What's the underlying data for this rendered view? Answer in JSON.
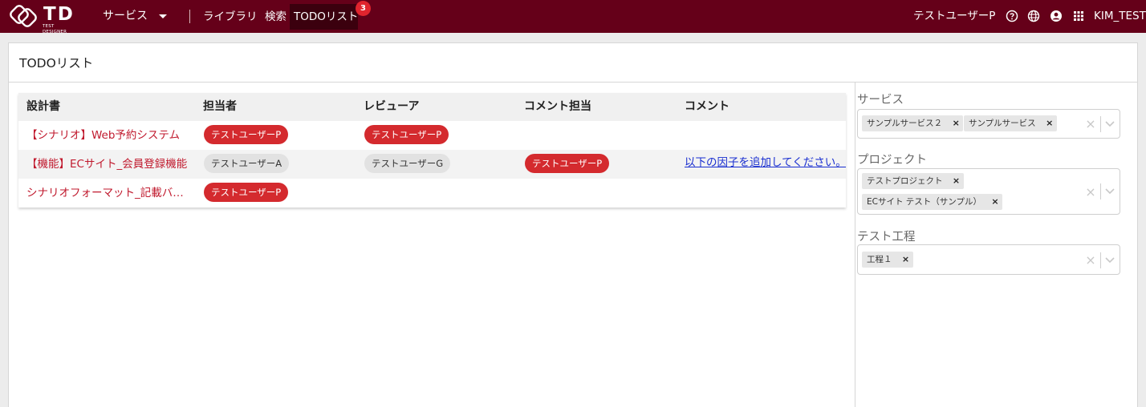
{
  "header": {
    "logo_text": "TD",
    "logo_sub": "TEST DESIGNER",
    "service_menu": "サービス",
    "nav": [
      "ライブラリ",
      "検索",
      "TODOリスト"
    ],
    "todo_badge": "3",
    "user_name": "テストユーザーP",
    "account": "KIM_TEST",
    "icons": [
      "help-icon",
      "globe-icon",
      "account-icon",
      "apps-grid-icon"
    ]
  },
  "main": {
    "title": "TODOリスト",
    "columns": [
      "設計書",
      "担当者",
      "レビューア",
      "コメント担当",
      "コメント"
    ],
    "rows": [
      {
        "doc": "【シナリオ】Web予約システム",
        "assignee": "テストユーザーP",
        "reviewer": "テストユーザーP",
        "comment_owner": "",
        "comment": ""
      },
      {
        "doc": "【機能】ECサイト_会員登録機能",
        "assignee": "テストユーザーA",
        "reviewer": "テストユーザーG",
        "comment_owner": "テストユーザーP",
        "comment": "以下の因子を追加してください。"
      },
      {
        "doc": "シナリオフォーマット_記載バリエーション",
        "assignee": "テストユーザーP",
        "reviewer": "",
        "comment_owner": "",
        "comment": ""
      }
    ]
  },
  "filters": {
    "service": {
      "label": "サービス",
      "tags": [
        "サンプルサービス２",
        "サンプルサービス"
      ]
    },
    "project": {
      "label": "プロジェクト",
      "tags": [
        "テストプロジェクト",
        "ECサイト テスト（サンプル）"
      ]
    },
    "phase": {
      "label": "テスト工程",
      "tags": [
        "工程１"
      ]
    }
  },
  "colors": {
    "header_bg": "#650019",
    "accent_red": "#d42a2e",
    "link_red": "#c0192d",
    "link_blue": "#1a2fd0"
  }
}
